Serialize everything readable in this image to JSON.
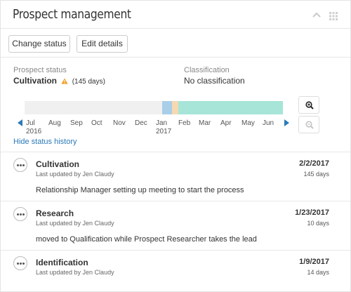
{
  "panel": {
    "title": "Prospect management"
  },
  "toolbar": {
    "change_status_label": "Change status",
    "edit_details_label": "Edit details"
  },
  "status": {
    "label": "Prospect status",
    "value": "Cultivation",
    "days": "(145 days)"
  },
  "classification": {
    "label": "Classification",
    "value": "No classification"
  },
  "timeline": {
    "months": [
      "Jul",
      "Aug",
      "Sep",
      "Oct",
      "Nov",
      "Dec",
      "Jan",
      "Feb",
      "Mar",
      "Apr",
      "May",
      "Jun"
    ],
    "years": [
      "2016",
      "2017"
    ],
    "colors": {
      "track": "#f0f0f0",
      "identification": "#a9cee8",
      "research": "#f6d8b1",
      "cultivation": "#a6e5d8"
    }
  },
  "hide_history_label": "Hide status history",
  "history": [
    {
      "title": "Cultivation",
      "updated": "Last updated by Jen Claudy",
      "note": "Relationship Manager setting up meeting to start the process",
      "date": "2/2/2017",
      "days": "145 days"
    },
    {
      "title": "Research",
      "updated": "Last updated by Jen Claudy",
      "note": "moved to Qualification while Prospect Researcher takes the lead",
      "date": "1/23/2017",
      "days": "10 days"
    },
    {
      "title": "Identification",
      "updated": "Last updated by Jen Claudy",
      "note": "",
      "date": "1/9/2017",
      "days": "14 days"
    }
  ]
}
